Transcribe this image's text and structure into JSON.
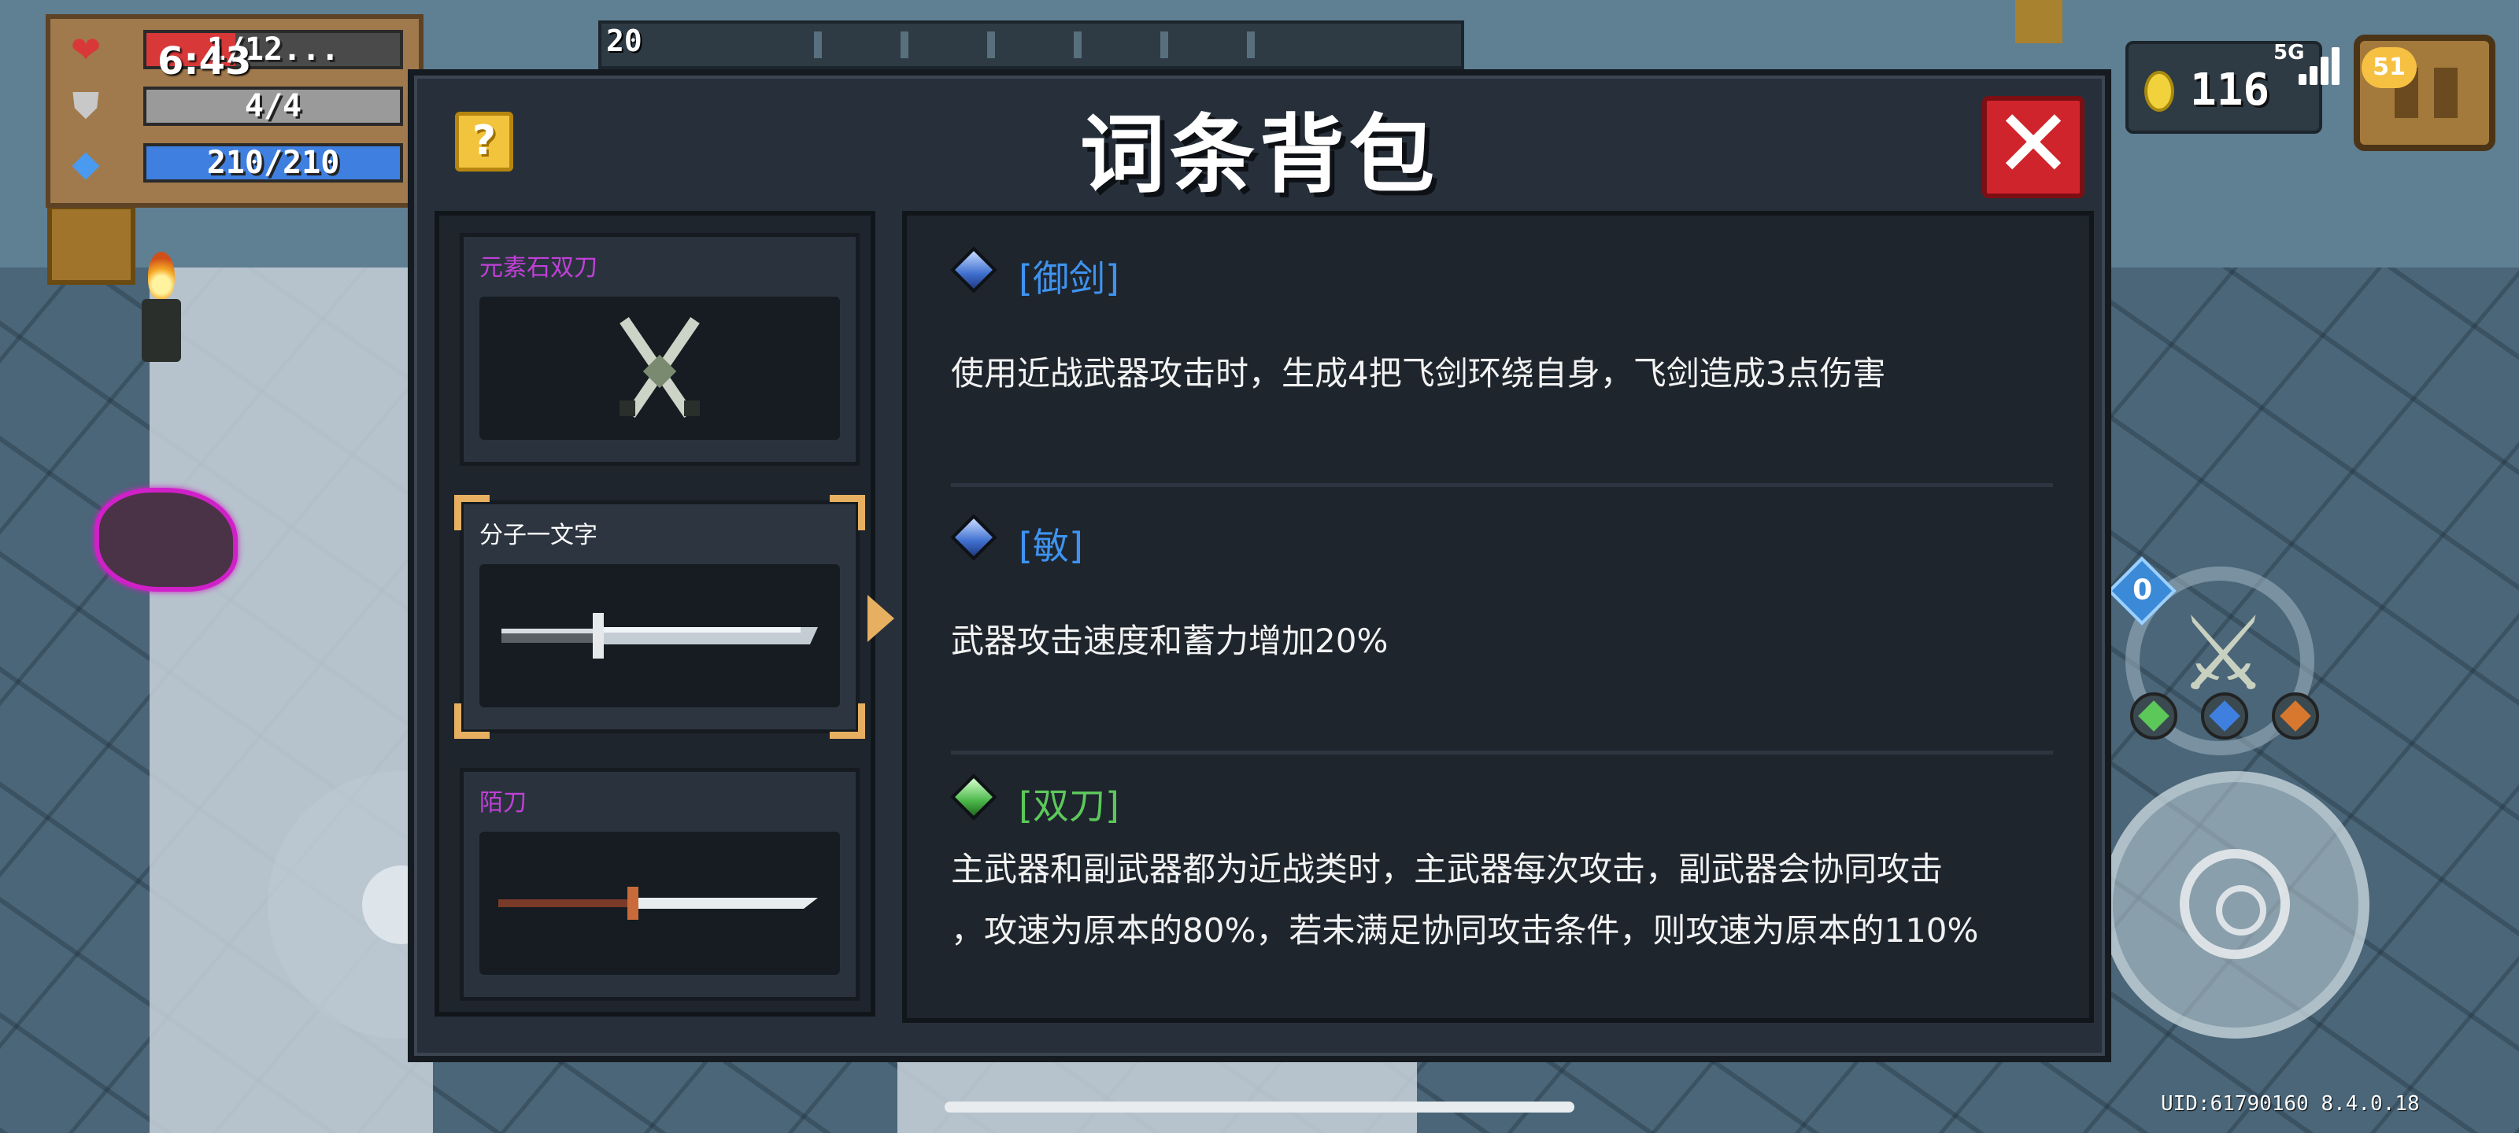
{
  "hud": {
    "health": "1/12...",
    "health_fraction": 0.35,
    "armor": "4/4",
    "armor_fraction": 1.0,
    "energy": "210/210",
    "energy_fraction": 1.0,
    "clock": "6:43",
    "buff_count": "20",
    "coins": "116",
    "network": "5G",
    "battery": "51",
    "weapon_counter": "0",
    "uid": "UID:61790160 8.4.0.18",
    "colors": {
      "health": "#d83838",
      "armor": "#9a9a9a",
      "energy": "#3f7fe0"
    }
  },
  "dialog": {
    "title": "词条背包",
    "help_label": "?",
    "close_label": "✕",
    "weapons": [
      {
        "name": "元素石双刀",
        "name_color": "#c040d8",
        "icon": "crossed-blades-icon"
      },
      {
        "name": "分子一文字",
        "name_color": "#ffffff",
        "icon": "katana-icon",
        "selected": true
      },
      {
        "name": "陌刀",
        "name_color": "#c040d8",
        "icon": "long-blade-icon"
      }
    ],
    "traits": [
      {
        "name": "[御剑]",
        "gem": "blue-gem-icon",
        "color": "#3f93f0",
        "desc": [
          "使用近战武器攻击时，生成4把飞剑环绕自身，飞剑造成3点伤害"
        ]
      },
      {
        "name": "[敏]",
        "gem": "blue-gem-icon",
        "color": "#3f93f0",
        "desc": [
          "武器攻击速度和蓄力增加20%"
        ]
      },
      {
        "name": "[双刀]",
        "gem": "green-gem-icon",
        "color": "#5cc85a",
        "desc": [
          "主武器和副武器都为近战类时，主武器每次攻击，副武器会协同攻击",
          "，攻速为原本的80%，若未满足协同攻击条件，则攻速为原本的110%"
        ]
      }
    ]
  }
}
